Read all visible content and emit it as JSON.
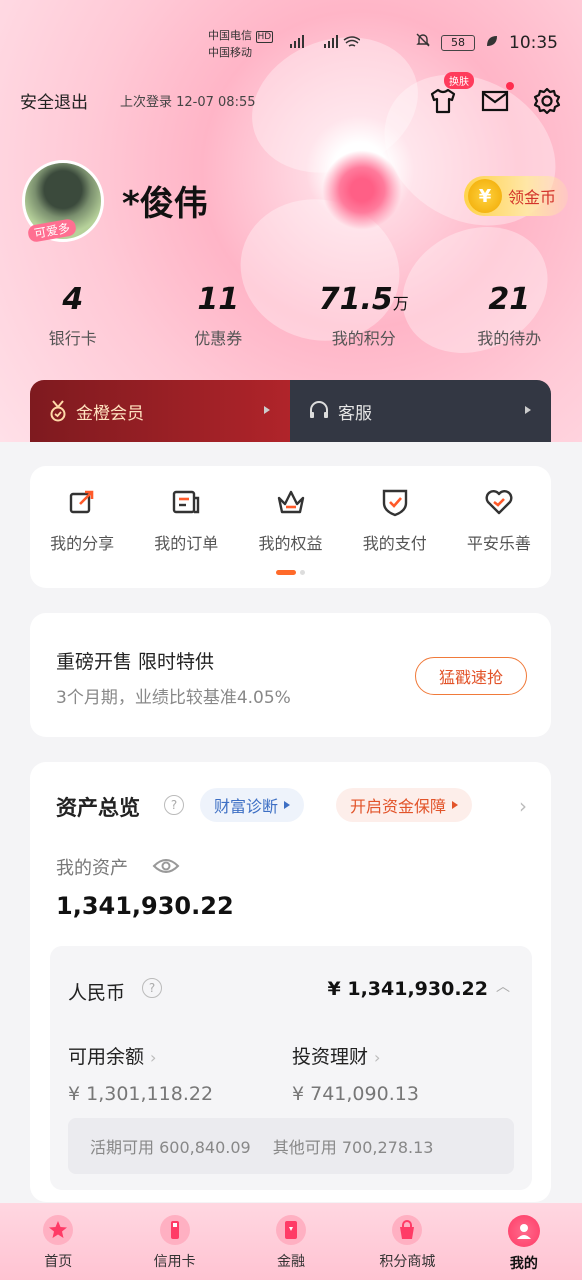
{
  "status_bar": {
    "carrier1": "中国电信",
    "hd": "HD",
    "carrier2": "中国移动",
    "battery": "58",
    "time": "10:35"
  },
  "header": {
    "logout": "安全退出",
    "last_login": "上次登录 12-07 08:55",
    "skin_badge": "换肤"
  },
  "profile": {
    "avatar_tag": "可爱多",
    "name": "*俊伟",
    "coin_button": "领金币",
    "coin_symbol": "¥"
  },
  "stats": [
    {
      "value": "4",
      "unit": "",
      "label": "银行卡"
    },
    {
      "value": "11",
      "unit": "",
      "label": "优惠券"
    },
    {
      "value": "71.5",
      "unit": "万",
      "label": "我的积分"
    },
    {
      "value": "21",
      "unit": "",
      "label": "我的待办"
    }
  ],
  "member_bar": {
    "member": "金橙会员",
    "service": "客服"
  },
  "shortcuts": [
    {
      "label": "我的分享",
      "icon": "share-icon"
    },
    {
      "label": "我的订单",
      "icon": "order-icon"
    },
    {
      "label": "我的权益",
      "icon": "crown-icon"
    },
    {
      "label": "我的支付",
      "icon": "shield-check-icon"
    },
    {
      "label": "平安乐善",
      "icon": "heart-icon"
    }
  ],
  "promo": {
    "title": "重磅开售 限时特供",
    "subtitle": "3个月期，业绩比较基准4.05%",
    "button": "猛戳速抢"
  },
  "assets": {
    "title": "资产总览",
    "diagnosis": "财富诊断",
    "protection": "开启资金保障",
    "my_assets_label": "我的资产",
    "total": "1,341,930.22",
    "currency_label": "人民币",
    "currency_amount": "¥ 1,341,930.22",
    "available_label": "可用余额",
    "available_value": "¥ 1,301,118.22",
    "invest_label": "投资理财",
    "invest_value": "¥ 741,090.13",
    "current_label": "活期可用",
    "current_value": "600,840.09",
    "other_label": "其他可用",
    "other_value": "700,278.13"
  },
  "bottom_nav": [
    {
      "label": "首页",
      "icon": "home-icon"
    },
    {
      "label": "信用卡",
      "icon": "credit-card-icon"
    },
    {
      "label": "金融",
      "icon": "finance-icon"
    },
    {
      "label": "积分商城",
      "icon": "shop-bag-icon"
    },
    {
      "label": "我的",
      "icon": "profile-icon",
      "active": true
    }
  ],
  "colors": {
    "accent_orange": "#e2542a",
    "member_red": "#9e1f26",
    "service_dark": "#333743",
    "link_blue": "#3d6fc4"
  }
}
